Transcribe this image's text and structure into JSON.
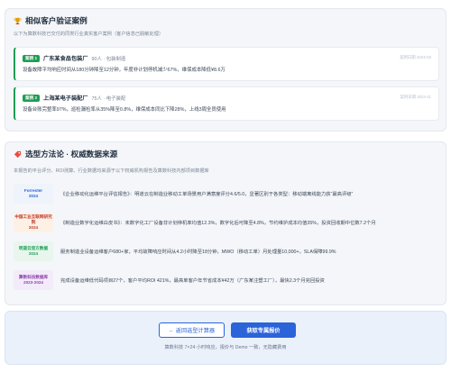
{
  "cases_section": {
    "title": "相似客户验证案例",
    "subtitle": "以下为算数科技已交付的同类行业真实客户案例（客户信息已脱敏处理）",
    "icon": "trophy-icon",
    "cases": [
      {
        "badge": "案例 1",
        "company": "广东某食品包装厂",
        "meta": "90人 · 包装制造",
        "date": "案例日期 2024-03",
        "body": "设备故障平均响应时间从180分钟降至12分钟，年度非计划停机减少67%，维保成本降低¥8.6万"
      },
      {
        "badge": "案例 2",
        "company": "上海某电子装配厂",
        "meta": "75人 · 电子装配",
        "date": "案例日期 2024-11",
        "body": "设备台账完整率97%，巡检漏检率从35%降至0.8%，维保成本同比下降28%，上线3周全员使用"
      }
    ]
  },
  "method_section": {
    "title": "选型方法论 · 权威数据来源",
    "subtitle": "本报告的平台评分、ROI测算、行业数据均来源于以下权威机构报告及算数科技内部项目数据库",
    "icon": "tag-icon",
    "sources": [
      {
        "logo_line1": "Forrester",
        "logo_line2": "2024",
        "logo_color": "#2b63d9",
        "logo_bg": "#eef3fc",
        "text": "《企业移动化运维平台评估报告》：明道云在制造业移动工单场景用户满意度评分4.6/5.0，显著区别于各类型：移动端离线能力获“最高评级”"
      },
      {
        "logo_line1": "中国工业互联网研究院",
        "logo_line2": "2024",
        "logo_color": "#c0392b",
        "logo_bg": "#fdf1e6",
        "text": "《制造业数字化运维白皮书》：未数字化工厂设备非计划停机率均值12.3%，数字化后可降至4.8%，节约维护成本均值35%，投资回收期中位数7.2个月"
      },
      {
        "logo_line1": "明道云官方数据",
        "logo_line2": "2024",
        "logo_color": "#1f9d55",
        "logo_bg": "#e8f6ee",
        "text": "服务制造业设备运维客户680+家，平均故障响应时间从4.2小时降至18分钟，MWO（移动工单）月处理量10,000+，SLA保障99.9%"
      },
      {
        "logo_line1": "算数科技数据库",
        "logo_line2": "2023-2024",
        "logo_color": "#8e44ad",
        "logo_bg": "#f3ebfa",
        "text": "完成设备运维低代码项目27个，客户平均ROI 421%，最高单客户年节省成本¥42万（广东某注塑工厂），最快2.3个月完回投资"
      }
    ]
  },
  "footer": {
    "back_label": "← 返回选型计算器",
    "quote_label": "获取专属报价",
    "note": "算数科技 7×24 小时响应，报价与 Demo 一致，无隐藏费用"
  }
}
